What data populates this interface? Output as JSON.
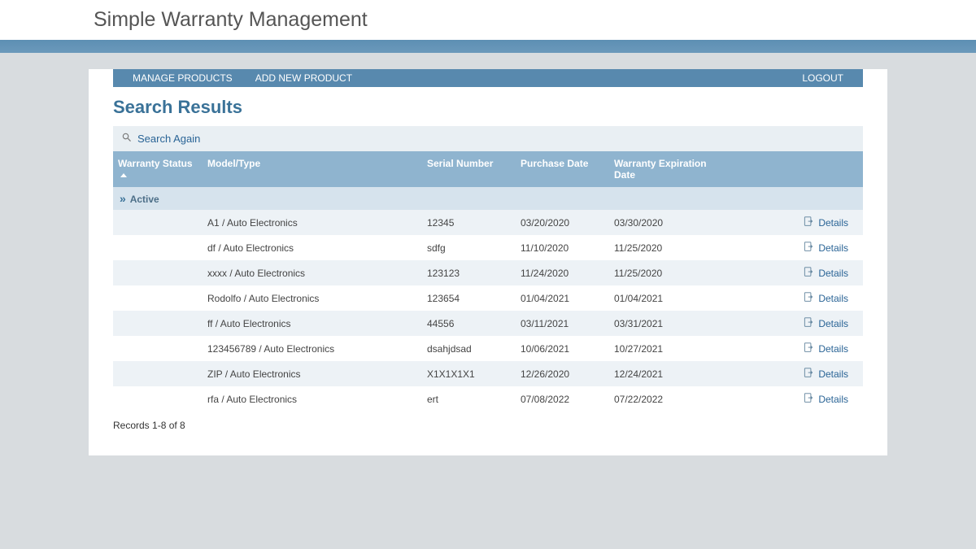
{
  "header": {
    "title": "Simple Warranty Management"
  },
  "nav": {
    "manage_products": "MANAGE PRODUCTS",
    "add_new_product": "ADD NEW PRODUCT",
    "logout": "LOGOUT"
  },
  "page": {
    "title": "Search Results",
    "search_again": "Search Again",
    "records_label": "Records 1-8 of 8"
  },
  "table": {
    "columns": {
      "warranty_status": "Warranty Status",
      "model_type": "Model/Type",
      "serial_number": "Serial Number",
      "purchase_date": "Purchase Date",
      "expiration_date": "Warranty Expiration Date"
    },
    "group_label": "Active",
    "details_label": "Details",
    "rows": [
      {
        "model": "A1 / Auto Electronics",
        "serial": "12345",
        "purchase": "03/20/2020",
        "expiry": "03/30/2020"
      },
      {
        "model": "df / Auto Electronics",
        "serial": "sdfg",
        "purchase": "11/10/2020",
        "expiry": "11/25/2020"
      },
      {
        "model": "xxxx / Auto Electronics",
        "serial": "123123",
        "purchase": "11/24/2020",
        "expiry": "11/25/2020"
      },
      {
        "model": "Rodolfo / Auto Electronics",
        "serial": "123654",
        "purchase": "01/04/2021",
        "expiry": "01/04/2021"
      },
      {
        "model": "ff / Auto Electronics",
        "serial": "44556",
        "purchase": "03/11/2021",
        "expiry": "03/31/2021"
      },
      {
        "model": "123456789 / Auto Electronics",
        "serial": "dsahjdsad",
        "purchase": "10/06/2021",
        "expiry": "10/27/2021"
      },
      {
        "model": "ZIP / Auto Electronics",
        "serial": "X1X1X1X1",
        "purchase": "12/26/2020",
        "expiry": "12/24/2021"
      },
      {
        "model": "rfa / Auto Electronics",
        "serial": "ert",
        "purchase": "07/08/2022",
        "expiry": "07/22/2022"
      }
    ]
  }
}
